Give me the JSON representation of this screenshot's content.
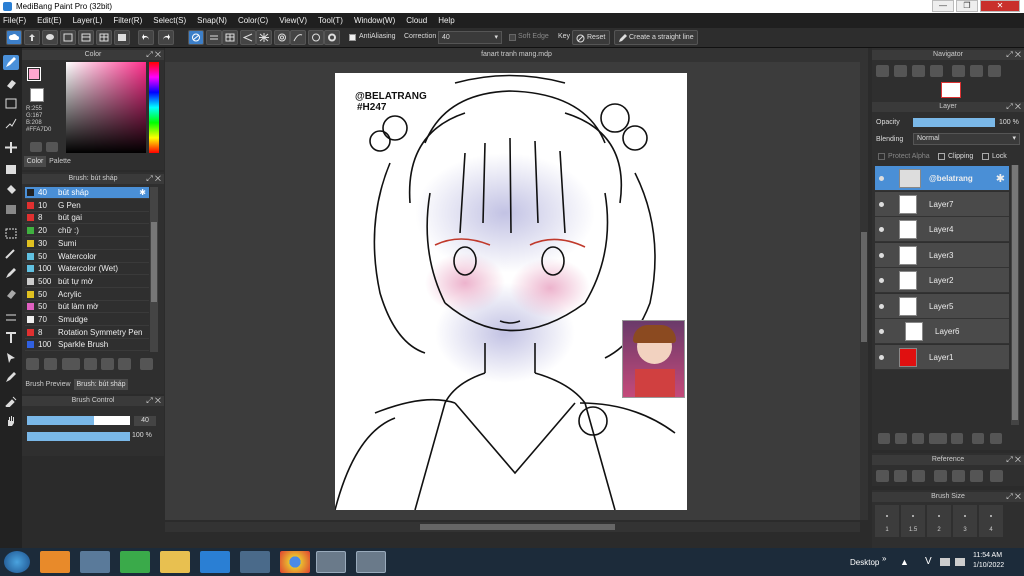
{
  "window": {
    "title": "MediBang Paint Pro (32bit)"
  },
  "menu": [
    "File(F)",
    "Edit(E)",
    "Layer(L)",
    "Filter(R)",
    "Select(S)",
    "Snap(N)",
    "Color(C)",
    "View(V)",
    "Tool(T)",
    "Window(W)",
    "Cloud",
    "Help"
  ],
  "toolbar": {
    "antialiasing": "AntiAliasing",
    "correction_label": "Correction",
    "correction_value": "40",
    "soft_edge": "Soft Edge",
    "key": "Key",
    "reset": "Reset",
    "straight_line": "Create a straight line"
  },
  "color_panel": {
    "title": "Color",
    "r": "R:255",
    "g": "G:167",
    "b": "B:208",
    "hex": "#FFA7D0",
    "tab_color": "Color",
    "tab_palette": "Palette",
    "fg": "#ffa7d0"
  },
  "brush_panel": {
    "title": "Brush: bút sháp",
    "items": [
      {
        "size": "40",
        "name": "bút sháp",
        "color": "#222222"
      },
      {
        "size": "10",
        "name": "G Pen",
        "color": "#e03030"
      },
      {
        "size": "8",
        "name": "bút gai",
        "color": "#e03030"
      },
      {
        "size": "20",
        "name": "chữ :)",
        "color": "#40b040"
      },
      {
        "size": "30",
        "name": "Sumi",
        "color": "#e0c020"
      },
      {
        "size": "50",
        "name": "Watercolor",
        "color": "#60c0e0"
      },
      {
        "size": "100",
        "name": "Watercolor (Wet)",
        "color": "#60c0e0"
      },
      {
        "size": "500",
        "name": "bút tự mờ",
        "color": "#cccccc"
      },
      {
        "size": "50",
        "name": "Acrylic",
        "color": "#e0c020"
      },
      {
        "size": "50",
        "name": "bút làm mờ",
        "color": "#e060c0"
      },
      {
        "size": "70",
        "name": "Smudge",
        "color": "#f0f0f0"
      },
      {
        "size": "8",
        "name": "Rotation Symmetry Pen",
        "color": "#e03030"
      },
      {
        "size": "100",
        "name": "Sparkle Brush",
        "color": "#3060e0"
      }
    ],
    "tab_preview": "Brush Preview",
    "tab_brush": "Brush: bút sháp"
  },
  "brush_control": {
    "title": "Brush Control",
    "size": "40",
    "size_frac": 0.65,
    "opacity": "100 %",
    "opacity_frac": 1.0
  },
  "canvas": {
    "filename": "fanart tranh mang.mdp",
    "signature1": "@BELATRANG",
    "signature2": "#H247"
  },
  "navigator": {
    "title": "Navigator"
  },
  "layer_panel": {
    "title": "Layer",
    "opacity_label": "Opacity",
    "opacity_value": "100 %",
    "blending_label": "Blending",
    "blending_value": "Normal",
    "protect_alpha": "Protect Alpha",
    "clipping": "Clipping",
    "lock": "Lock",
    "layers": [
      {
        "name": "@belatrang",
        "selected": true
      },
      {
        "name": "Layer7"
      },
      {
        "name": "Layer4"
      },
      {
        "name": "Layer3"
      },
      {
        "name": "Layer2"
      },
      {
        "name": "Layer5"
      },
      {
        "name": "Layer6"
      },
      {
        "name": "Layer1"
      }
    ]
  },
  "reference": {
    "title": "Reference"
  },
  "brush_size": {
    "title": "Brush Size",
    "values": [
      "1",
      "1.5",
      "2",
      "3",
      "4"
    ]
  },
  "taskbar": {
    "desktop": "Desktop",
    "time": "11:54 AM",
    "date": "1/10/2022"
  }
}
